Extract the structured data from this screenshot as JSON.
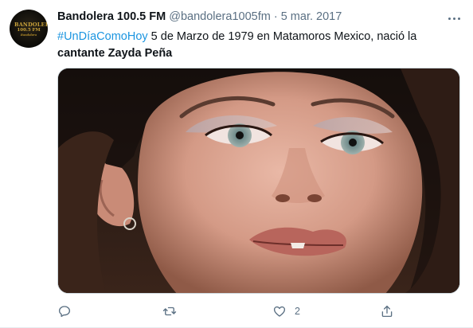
{
  "account": {
    "avatar_text": {
      "line1": "BANDOLERA",
      "line2": "100.5 FM",
      "line3": "Bandolera"
    },
    "name": "Bandolera 100.5 FM",
    "handle": "@bandolera1005fm",
    "separator": "·",
    "date": "5 mar. 2017"
  },
  "tweet": {
    "hashtag": "#UnDíaComoHoy",
    "text_part1": " 5 de Marzo de 1979 en Matamoros Mexico, nació la",
    "text_bold": "cantante Zayda Peña"
  },
  "media": {
    "icon": "photo-of-woman-face"
  },
  "actions": {
    "reply": {
      "icon": "reply-icon"
    },
    "retweet": {
      "icon": "retweet-icon"
    },
    "like": {
      "icon": "heart-icon",
      "count": "2"
    },
    "share": {
      "icon": "share-icon"
    }
  },
  "colors": {
    "link": "#1b95e0",
    "secondary": "#5b7083",
    "text": "#0f1419"
  }
}
